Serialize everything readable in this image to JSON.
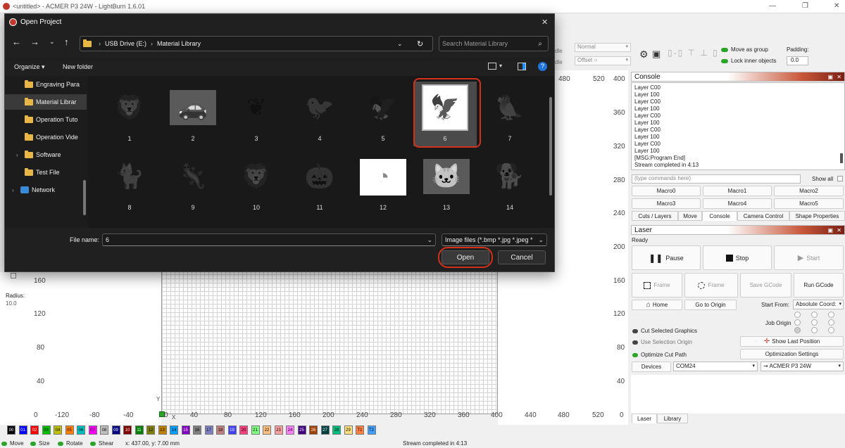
{
  "app": {
    "window_title": "<untitled> - ACMER P3 24W - LightBurn 1.6.01",
    "win_controls": [
      "—",
      "❐",
      "✕"
    ]
  },
  "toolbar": {
    "mode_select": "Normal",
    "offset_label": "Offset",
    "dle1": "dle",
    "dle2": "dle",
    "move_as_group": "Move as group",
    "lock_inner_objects": "Lock inner objects",
    "padding_label": "Padding:",
    "padding_value": "0.0"
  },
  "left_tools": {
    "radius_label": "Radius:",
    "radius_value": "10.0"
  },
  "rulers": {
    "top": [
      {
        "v": "480"
      },
      {
        "v": "520"
      },
      {
        "v": "400"
      }
    ],
    "right": [
      "360",
      "320",
      "280",
      "240",
      "200",
      "160",
      "120",
      "80",
      "40",
      "0"
    ],
    "left": [
      "160",
      "120",
      "80",
      "40",
      "0"
    ],
    "bottom": [
      "-120",
      "-80",
      "-40",
      "0",
      "40",
      "80",
      "120",
      "160",
      "200",
      "240",
      "280",
      "320",
      "360",
      "400",
      "440",
      "480",
      "520"
    ],
    "axis_x": "X",
    "axis_y": "Y"
  },
  "console": {
    "title": "Console",
    "lines": [
      "Layer C00",
      "Layer 100",
      "Layer C00",
      "Layer 100",
      "Layer C00",
      "Layer 100",
      "Layer C00",
      "Layer 100",
      "Layer C00",
      "Layer 100",
      "[MSG:Program End]",
      "Stream completed in 4:13"
    ],
    "command_placeholder": "(type commands here)",
    "show_all": "Show all",
    "macros": [
      "Macro0",
      "Macro1",
      "Macro2",
      "Macro3",
      "Macro4",
      "Macro5"
    ],
    "tabs": [
      "Cuts / Layers",
      "Move",
      "Console",
      "Camera Control",
      "Shape Properties"
    ]
  },
  "laser": {
    "title": "Laser",
    "status": "Ready",
    "pause": "Pause",
    "stop": "Stop",
    "start": "Start",
    "frame1": "Frame",
    "frame2": "Frame",
    "save_gcode": "Save GCode",
    "run_gcode": "Run GCode",
    "home": "Home",
    "go_to_origin": "Go to Origin",
    "start_from_label": "Start From:",
    "start_from_value": "Absolute Coord:",
    "job_origin": "Job Origin",
    "cut_selected": "Cut Selected Graphics",
    "use_selection_origin": "Use Selection Origin",
    "optimize_cut_path": "Optimize Cut Path",
    "show_last_position": "Show Last Position",
    "optimization_settings": "Optimization Settings",
    "devices": "Devices",
    "port": "COM24",
    "device": "ACMER P3 24W",
    "bottom_tabs": [
      "Laser",
      "Library"
    ]
  },
  "dialog": {
    "title": "Open Project",
    "close": "✕",
    "breadcrumb": [
      "USB Drive (E:)",
      "Material Library"
    ],
    "search_placeholder": "Search Material Library",
    "organize": "Organize ▾",
    "new_folder": "New folder",
    "sidebar": [
      {
        "label": "Engraving Para",
        "type": "folder"
      },
      {
        "label": "Material Librar",
        "type": "folder"
      },
      {
        "label": "Operation Tuto",
        "type": "folder"
      },
      {
        "label": "Operation Vide",
        "type": "folder"
      },
      {
        "label": "Software",
        "type": "folder"
      },
      {
        "label": "Test File",
        "type": "folder"
      },
      {
        "label": "Network",
        "type": "network"
      }
    ],
    "files": [
      {
        "name": "1",
        "icon": "lion-icon",
        "style": "faded"
      },
      {
        "name": "2",
        "icon": "car-icon",
        "style": "photo"
      },
      {
        "name": "3",
        "icon": "antlers-icon",
        "style": "faded"
      },
      {
        "name": "4",
        "icon": "bird-icon",
        "style": "faded"
      },
      {
        "name": "5",
        "icon": "eagle-icon",
        "style": "faded"
      },
      {
        "name": "6",
        "icon": "eagle-head-icon",
        "style": "selected"
      },
      {
        "name": "7",
        "icon": "parrot-icon",
        "style": "faded"
      },
      {
        "name": "8",
        "icon": "cat-icon",
        "style": "faded"
      },
      {
        "name": "9",
        "icon": "lizard-icon",
        "style": "faded"
      },
      {
        "name": "10",
        "icon": "lion-icon",
        "style": "faded"
      },
      {
        "name": "11",
        "icon": "pumpkin-icon",
        "style": "faded"
      },
      {
        "name": "12",
        "icon": "chart-icon",
        "style": "chart"
      },
      {
        "name": "13",
        "icon": "cat-face-icon",
        "style": "photo"
      },
      {
        "name": "14",
        "icon": "animal-icon",
        "style": "faded"
      }
    ],
    "filename_label": "File name:",
    "filename_value": "6",
    "filetype": "Image files (*.bmp *.jpg *.jpeg *",
    "open": "Open",
    "cancel": "Cancel"
  },
  "palette": [
    {
      "l": "00",
      "c": "#000000",
      "t": "#fff"
    },
    {
      "l": "01",
      "c": "#0000ff",
      "t": "#fff"
    },
    {
      "l": "02",
      "c": "#ff0000",
      "t": "#fff"
    },
    {
      "l": "03",
      "c": "#00c000",
      "t": "#000"
    },
    {
      "l": "04",
      "c": "#c0c000",
      "t": "#000"
    },
    {
      "l": "05",
      "c": "#ff8000",
      "t": "#000"
    },
    {
      "l": "06",
      "c": "#00c0c0",
      "t": "#000"
    },
    {
      "l": "07",
      "c": "#ff00ff",
      "t": "#000"
    },
    {
      "l": "08",
      "c": "#c0c0c0",
      "t": "#000"
    },
    {
      "l": "09",
      "c": "#000080",
      "t": "#fff"
    },
    {
      "l": "10",
      "c": "#800000",
      "t": "#fff"
    },
    {
      "l": "11",
      "c": "#008000",
      "t": "#fff"
    },
    {
      "l": "12",
      "c": "#808000",
      "t": "#000"
    },
    {
      "l": "13",
      "c": "#c08000",
      "t": "#000"
    },
    {
      "l": "14",
      "c": "#00a0ff",
      "t": "#000"
    },
    {
      "l": "15",
      "c": "#8000c0",
      "t": "#fff"
    },
    {
      "l": "16",
      "c": "#808080",
      "t": "#000"
    },
    {
      "l": "17",
      "c": "#8080c0",
      "t": "#000"
    },
    {
      "l": "18",
      "c": "#c08080",
      "t": "#000"
    },
    {
      "l": "19",
      "c": "#4040ff",
      "t": "#fff"
    },
    {
      "l": "20",
      "c": "#ff4080",
      "t": "#000"
    },
    {
      "l": "21",
      "c": "#80ff80",
      "t": "#000"
    },
    {
      "l": "22",
      "c": "#ffc080",
      "t": "#000"
    },
    {
      "l": "23",
      "c": "#ffa0a0",
      "t": "#000"
    },
    {
      "l": "24",
      "c": "#ff80ff",
      "t": "#000"
    },
    {
      "l": "25",
      "c": "#400080",
      "t": "#fff"
    },
    {
      "l": "26",
      "c": "#a04000",
      "t": "#fff"
    },
    {
      "l": "27",
      "c": "#004040",
      "t": "#fff"
    },
    {
      "l": "28",
      "c": "#00c080",
      "t": "#000"
    },
    {
      "l": "29",
      "c": "#ffe080",
      "t": "#000"
    },
    {
      "l": "T1",
      "c": "#ff8040",
      "t": "#000"
    },
    {
      "l": "T2",
      "c": "#40a0ff",
      "t": "#000"
    }
  ],
  "statusbar": {
    "move": "Move",
    "size": "Size",
    "rotate": "Rotate",
    "shear": "Shear",
    "coords": "x: 437.00, y: 7.00 mm",
    "message": "Stream completed in 4:13"
  }
}
